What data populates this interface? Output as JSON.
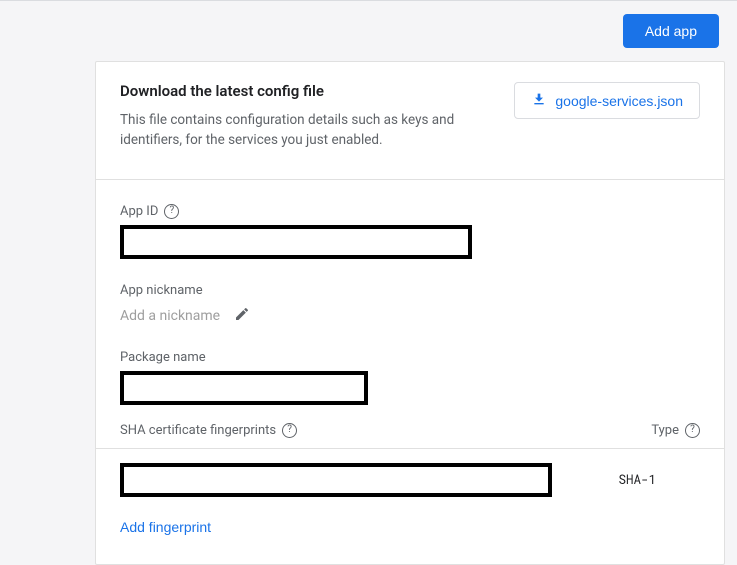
{
  "header": {
    "add_app_label": "Add app"
  },
  "config": {
    "title": "Download the latest config file",
    "description": "This file contains configuration details such as keys and identifiers, for the services you just enabled.",
    "download_label": "google-services.json"
  },
  "fields": {
    "app_id_label": "App ID",
    "nickname_label": "App nickname",
    "nickname_placeholder": "Add a nickname",
    "package_name_label": "Package name"
  },
  "sha": {
    "header_label": "SHA certificate fingerprints",
    "type_header": "Type",
    "type_value": "SHA-1",
    "add_label": "Add fingerprint"
  }
}
